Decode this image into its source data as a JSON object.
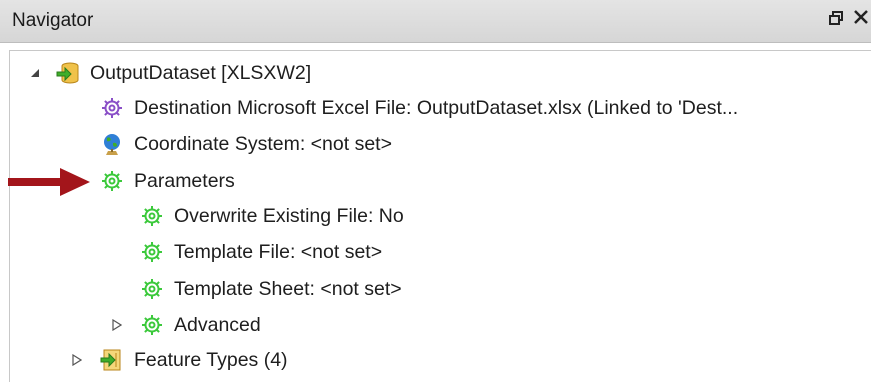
{
  "window": {
    "title": "Navigator",
    "restore_glyph": "🗗",
    "close_glyph": "✕"
  },
  "tree": {
    "root": {
      "label": "OutputDataset [XLSXW2]",
      "icon": "database-writer-icon",
      "expanded": true
    },
    "children": [
      {
        "label": "Destination Microsoft Excel File: OutputDataset.xlsx (Linked to 'Dest...",
        "icon": "purple-gear-icon"
      },
      {
        "label": "Coordinate System: <not set>",
        "icon": "globe-icon"
      },
      {
        "label": "Parameters",
        "icon": "green-gear-icon",
        "highlighted_by_arrow": true
      },
      {
        "label": "Overwrite Existing File: No",
        "icon": "green-gear-icon"
      },
      {
        "label": "Template File: <not set>",
        "icon": "green-gear-icon"
      },
      {
        "label": "Template Sheet: <not set>",
        "icon": "green-gear-icon"
      },
      {
        "label": "Advanced",
        "icon": "green-gear-icon",
        "collapsed": true
      },
      {
        "label": "Feature Types (4)",
        "icon": "feature-types-icon",
        "collapsed": true
      }
    ]
  },
  "colors": {
    "arrow": "#a3151b",
    "green_gear": "#3cc93c",
    "purple_gear": "#8a4fc7",
    "titlebar": "#dcdcdc"
  }
}
